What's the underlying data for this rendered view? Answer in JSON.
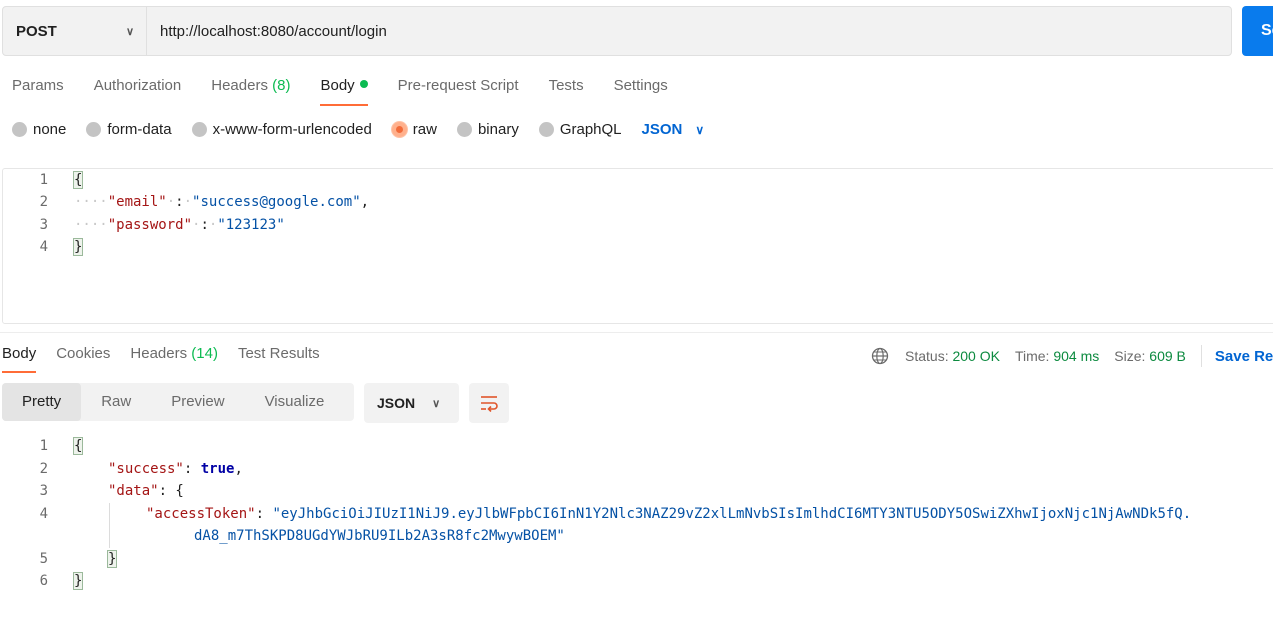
{
  "request": {
    "method": "POST",
    "url": "http://localhost:8080/account/login",
    "send_label": "Send",
    "tabs": [
      {
        "label": "Params"
      },
      {
        "label": "Authorization"
      },
      {
        "label": "Headers",
        "count": "(8)"
      },
      {
        "label": "Body"
      },
      {
        "label": "Pre-request Script"
      },
      {
        "label": "Tests"
      },
      {
        "label": "Settings"
      }
    ],
    "body_types": [
      "none",
      "form-data",
      "x-www-form-urlencoded",
      "raw",
      "binary",
      "GraphQL"
    ],
    "selected_body_type": "raw",
    "language": "JSON",
    "line_numbers": [
      "1",
      "2",
      "3",
      "4"
    ],
    "lines": {
      "open": "{",
      "email_key": "\"email\"",
      "email_value": "\"success@google.com\"",
      "password_key": "\"password\"",
      "password_value": "\"123123\"",
      "close": "}"
    }
  },
  "response": {
    "tabs": [
      {
        "label": "Body"
      },
      {
        "label": "Cookies"
      },
      {
        "label": "Headers",
        "count": "(14)"
      },
      {
        "label": "Test Results"
      }
    ],
    "status_label": "Status:",
    "status_value": "200 OK",
    "time_label": "Time:",
    "time_value": "904 ms",
    "size_label": "Size:",
    "size_value": "609 B",
    "save_label": "Save Response",
    "view_tabs": [
      "Pretty",
      "Raw",
      "Preview",
      "Visualize"
    ],
    "format": "JSON",
    "line_numbers": [
      "1",
      "2",
      "3",
      "4",
      "5",
      "6"
    ],
    "lines": {
      "open": "{",
      "success_key": "\"success\"",
      "success_value": "true",
      "data_key": "\"data\"",
      "token_key": "\"accessToken\"",
      "token_value_1": "\"eyJhbGciOiJIUzI1NiJ9.eyJlbWFpbCI6InN1Y2Nlc3NAZ29vZ2xlLmNvbSIsImlhdCI6MTY3NTU5ODY5OSwiZXhwIjoxNjc1NjAwNDk5fQ.",
      "token_value_2": "dA8_m7ThSKPD8UGdYWJbRU9ILb2A3sR8fc2MwywBOEM\"",
      "inner_close": "}",
      "close": "}"
    }
  },
  "colors": {
    "accent_orange": "#ff6c37",
    "primary_blue": "#097bed",
    "success_green": "#0cbb52"
  }
}
